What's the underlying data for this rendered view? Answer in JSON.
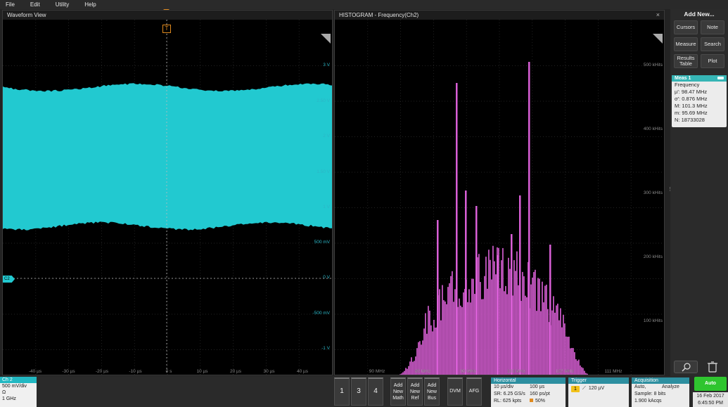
{
  "menu": [
    "File",
    "Edit",
    "Utility",
    "Help"
  ],
  "waveform": {
    "title": "Waveform View",
    "trigger_marker": "T",
    "channel_marker": "C2",
    "y_labels": [
      "3 V",
      "2.50 V",
      "2 V",
      "1.50 V",
      "1 V",
      "500 mV",
      "0 V",
      "-500 mV",
      "-1 V"
    ],
    "x_labels": [
      "-40 µs",
      "-30 µs",
      "-20 µs",
      "-10 µs",
      "0 s",
      "10 µs",
      "20 µs",
      "30 µs",
      "40 µs"
    ],
    "color": "#22c9d0"
  },
  "histogram": {
    "title": "HISTOGRAM - Frequency(Ch2)",
    "close": "×",
    "y_labels": [
      "500 kHits",
      "400 kHits",
      "300 kHits",
      "200 kHits",
      "100 kHits"
    ],
    "x_labels": [
      "90 MHz",
      "95 MHz",
      "99 MHz",
      "103 MHz",
      "107 MHz",
      "111 MHz"
    ],
    "color": "#d95fd6"
  },
  "right_panel": {
    "title": "Add New...",
    "buttons": [
      {
        "label": "Cursors"
      },
      {
        "label": "Note"
      },
      {
        "label": "Measure"
      },
      {
        "label": "Search"
      },
      {
        "label": "Results Table",
        "line1": "Results",
        "line2": "Table"
      },
      {
        "label": "Plot"
      }
    ],
    "measurement": {
      "header": "Meas 1",
      "name": "Frequency",
      "lines": [
        "µ': 98.47 MHz",
        "σ': 0.876 MHz",
        "M: 101.3 MHz",
        "m: 95.69 MHz",
        "N: 18733028"
      ]
    },
    "auto_label": "Auto",
    "date": "16 Feb 2017",
    "time": "6:45:50 PM"
  },
  "bottom": {
    "channel": {
      "name": "Ch 2",
      "lines": [
        "500 mV/div",
        "Ω",
        "1 GHz"
      ]
    },
    "ch_buttons": [
      "1",
      "3",
      "4"
    ],
    "add_buttons": [
      {
        "l1": "Add",
        "l2": "New",
        "l3": "Math"
      },
      {
        "l1": "Add",
        "l2": "New",
        "l3": "Ref"
      },
      {
        "l1": "Add",
        "l2": "New",
        "l3": "Bus"
      }
    ],
    "dvm": "DVM",
    "afg": "AFG",
    "horizontal": {
      "title": "Horizontal",
      "r1a": "10 µs/div",
      "r1b": "100 µs",
      "r2a": "SR: 6.25 GS/s",
      "r2b": "160 ps/pt",
      "r3a": "RL: 625 kpts",
      "r3b": "50%"
    },
    "trigger": {
      "title": "Trigger",
      "ch": "1",
      "level": "120 µV"
    },
    "acquisition": {
      "title": "Acquisition",
      "r1a": "Auto,",
      "r1b": "Analyze",
      "r2": "Sample: 8 bits",
      "r3": "1.900 kAcqs"
    }
  }
}
